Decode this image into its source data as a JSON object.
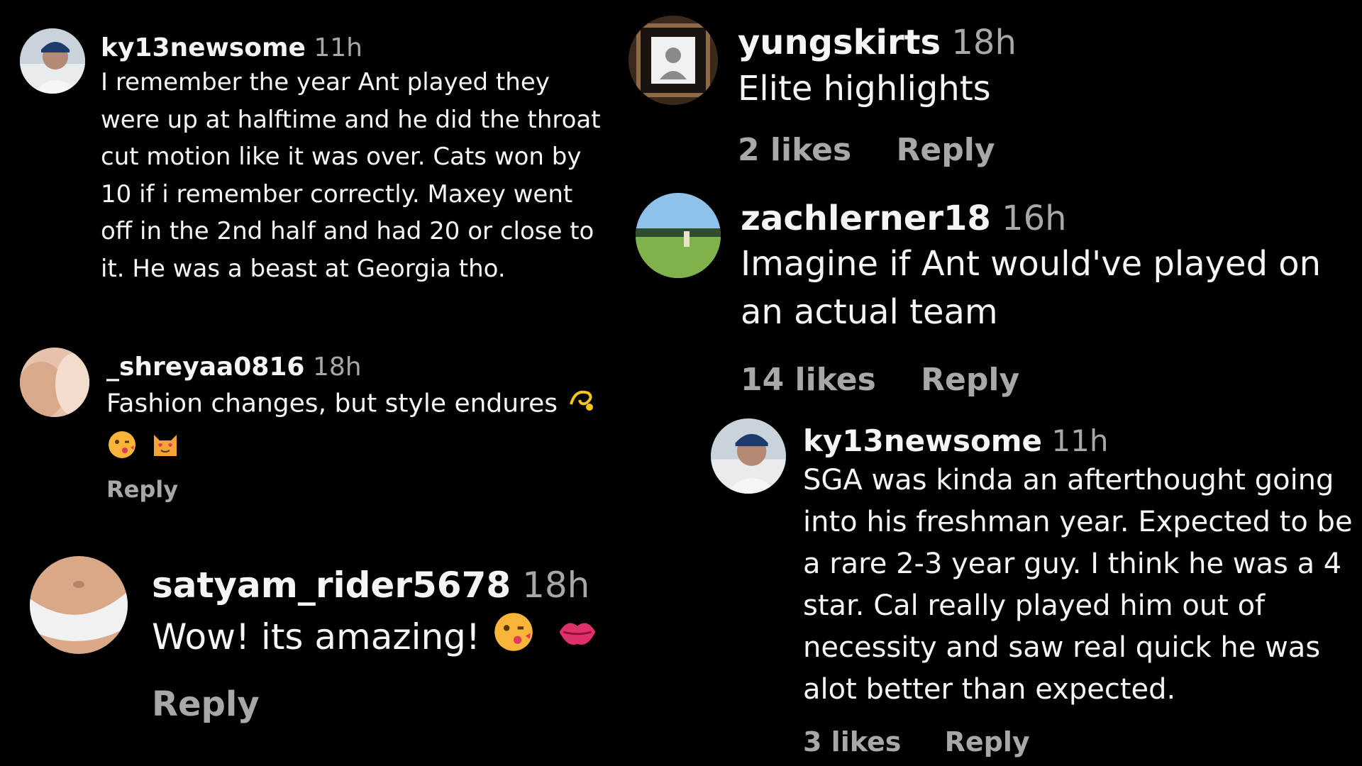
{
  "comments": [
    {
      "username": "ky13newsome",
      "time": "11h",
      "text": "I remember the year Ant played they were up at halftime and he did the throat cut motion like it was over. Cats won by 10 if i remember correctly. Maxey went off in the 2nd half and had 20 or close to it. He was a beast at Georgia tho.",
      "avatar_icon": "person-photo-icon"
    },
    {
      "username": "_shreyaa0816",
      "time": "18h",
      "text": "Fashion changes, but style endures",
      "emojis": [
        "dizzy-icon",
        "face-blowing-kiss-icon",
        "smiling-cat-heart-eyes-icon"
      ],
      "reply_label": "Reply"
    },
    {
      "username": "satyam_rider5678",
      "time": "18h",
      "text": "Wow! its amazing!",
      "emojis": [
        "face-blowing-kiss-icon",
        "kiss-mark-icon"
      ],
      "reply_label": "Reply"
    },
    {
      "username": "yungskirts",
      "time": "18h",
      "text": "Elite highlights",
      "likes": "2 likes",
      "reply_label": "Reply"
    },
    {
      "username": "zachlerner18",
      "time": "16h",
      "text": "Imagine if Ant would've played on an actual team",
      "likes": "14 likes",
      "reply_label": "Reply"
    },
    {
      "username": "ky13newsome",
      "time": "11h",
      "text": "SGA was kinda an afterthought going into his freshman year. Expected to be a rare 2-3 year guy. I think he was a 4 star. Cal really played him out of necessity and saw real quick he was alot better than expected.",
      "likes": "3 likes",
      "reply_label": "Reply"
    }
  ],
  "colors": {
    "background": "#000000",
    "text": "#f5f5f5",
    "secondary": "#a8a8a8"
  }
}
